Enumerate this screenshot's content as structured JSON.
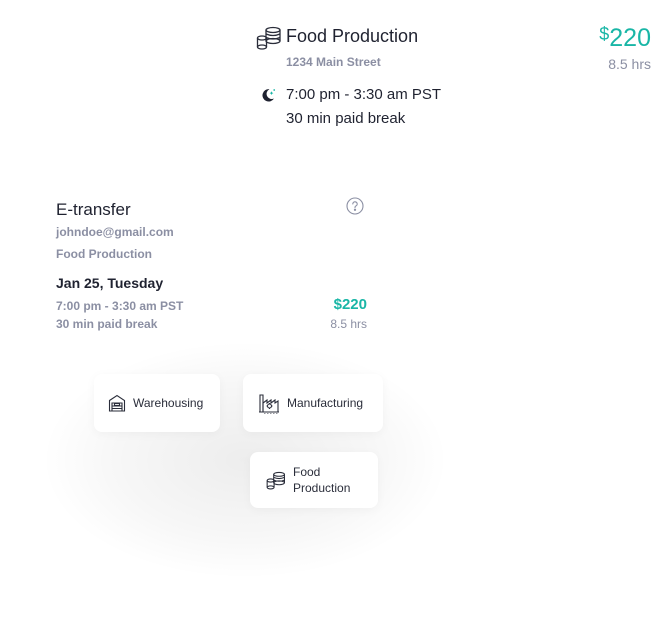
{
  "shift": {
    "icon": "food-production-icon",
    "title": "Food Production",
    "address": "1234 Main Street",
    "pay_currency": "$",
    "pay_amount": "220",
    "hours": "8.5 hrs",
    "time_icon": "moon-night-icon",
    "time": "7:00 pm - 3:30 am PST",
    "break": "30 min paid break"
  },
  "etransfer": {
    "title": "E-transfer",
    "help_icon": "question-circle-icon",
    "email": "johndoe@gmail.com",
    "role": "Food Production",
    "date": "Jan 25, Tuesday",
    "time": "7:00 pm - 3:30 am PST",
    "break": "30 min paid break",
    "pay": "$220",
    "hours": "8.5 hrs"
  },
  "categories": [
    {
      "label": "Warehousing",
      "icon": "warehouse-icon"
    },
    {
      "label": "Manufacturing",
      "icon": "factory-icon"
    },
    {
      "label": "Food Production",
      "icon": "food-production-icon"
    }
  ],
  "colors": {
    "accent": "#19b6a6",
    "muted_text": "#8b8fa3",
    "primary_text": "#1f2230"
  }
}
